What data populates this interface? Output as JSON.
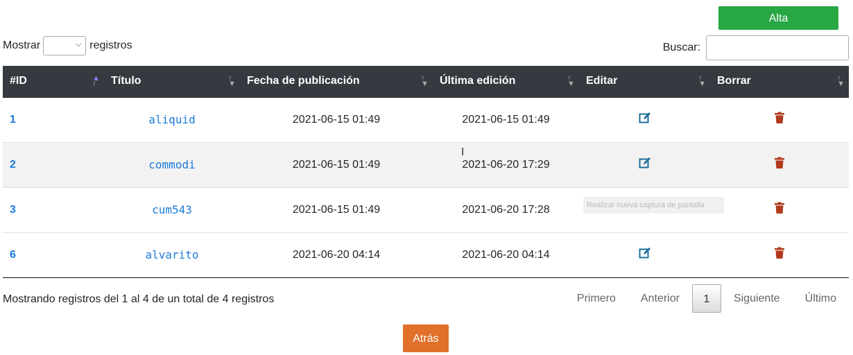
{
  "toolbar": {
    "alta_label": "Alta"
  },
  "length": {
    "prefix": "Mostrar",
    "suffix": "registros",
    "value": ""
  },
  "search": {
    "label": "Buscar:",
    "value": ""
  },
  "table": {
    "headers": [
      "#ID",
      "Título",
      "Fecha de publicación",
      "Última edición",
      "Editar",
      "Borrar"
    ],
    "rows": [
      {
        "id": "1",
        "title": "aliquid",
        "published": "2021-06-15 01:49",
        "edited": "2021-06-15 01:49"
      },
      {
        "id": "2",
        "title": "commodi",
        "published": "2021-06-15 01:49",
        "edited": "2021-06-20 17:29"
      },
      {
        "id": "3",
        "title": "cum543",
        "published": "2021-06-15 01:49",
        "edited": "2021-06-20 17:28"
      },
      {
        "id": "6",
        "title": "alvarito",
        "published": "2021-06-20 04:14",
        "edited": "2021-06-20 04:14"
      }
    ]
  },
  "tooltip": "Realizar nueva captura de pantalla",
  "footer": {
    "info": "Mostrando registros del 1 al 4 de un total de 4 registros",
    "pager": {
      "first": "Primero",
      "prev": "Anterior",
      "current": "1",
      "next": "Siguiente",
      "last": "Último"
    }
  },
  "back_label": "Atrás",
  "colors": {
    "alta": "#28a745",
    "header_bg": "#343a40",
    "link": "#1a7ad9",
    "edit_icon": "#1f6f9c",
    "delete_icon": "#b23a1c",
    "back": "#e0702a"
  },
  "icons": {
    "edit": "edit-icon",
    "delete": "trash-icon",
    "sort": "sort-icon"
  }
}
